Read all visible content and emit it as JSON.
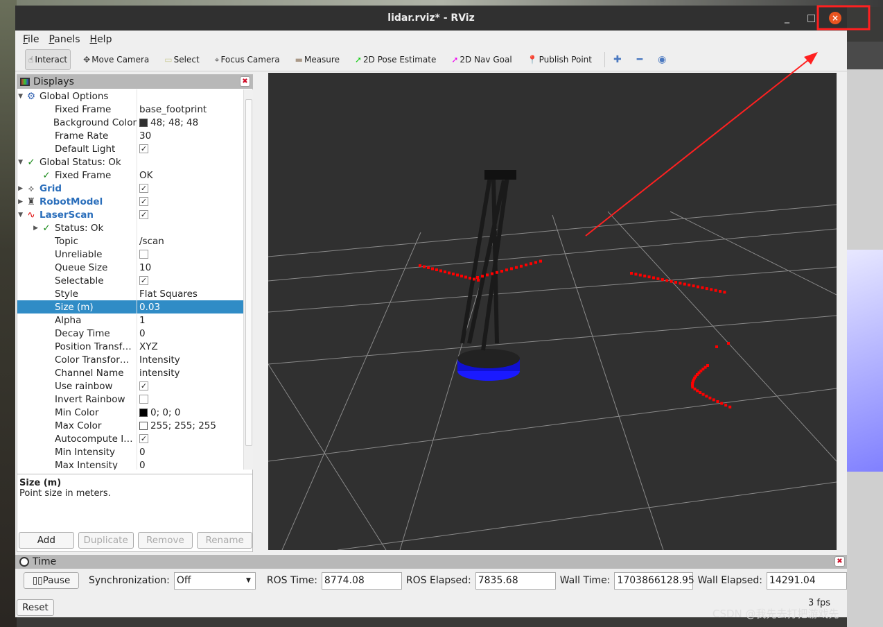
{
  "window": {
    "title": "lidar.rviz* - RViz",
    "minimize": "_",
    "maximize": "□",
    "close": "×"
  },
  "menu": [
    "File",
    "Panels",
    "Help"
  ],
  "toolbar": {
    "tools": [
      {
        "label": "Interact",
        "icon": "hand-icon",
        "active": true
      },
      {
        "label": "Move Camera",
        "icon": "move-camera-icon"
      },
      {
        "label": "Select",
        "icon": "select-icon"
      },
      {
        "label": "Focus Camera",
        "icon": "focus-camera-icon"
      },
      {
        "label": "Measure",
        "icon": "ruler-icon"
      },
      {
        "label": "2D Pose Estimate",
        "icon": "green-arrow-icon"
      },
      {
        "label": "2D Nav Goal",
        "icon": "magenta-arrow-icon"
      },
      {
        "label": "Publish Point",
        "icon": "map-pin-icon"
      }
    ],
    "extra": [
      "plus-icon",
      "minus-icon",
      "eye-icon"
    ]
  },
  "displays": {
    "title": "Displays",
    "rows": [
      {
        "lvl": 0,
        "exp": "down",
        "icon": "gear-icon",
        "key": "Global Options",
        "val": ""
      },
      {
        "lvl": 1,
        "key": "Fixed Frame",
        "val": "base_footprint"
      },
      {
        "lvl": 1,
        "key": "Background Color",
        "val": "48; 48; 48",
        "swatch": "#303030"
      },
      {
        "lvl": 1,
        "key": "Frame Rate",
        "val": "30"
      },
      {
        "lvl": 1,
        "key": "Default Light",
        "check": true
      },
      {
        "lvl": 0,
        "exp": "down",
        "icon": "check-icon",
        "key": "Global Status: Ok",
        "val": ""
      },
      {
        "lvl": 1,
        "icon": "check-icon",
        "key": "Fixed Frame",
        "val": "OK"
      },
      {
        "lvl": 0,
        "exp": "right",
        "icon": "grid-icon",
        "key": "Grid",
        "bold": true,
        "check": true
      },
      {
        "lvl": 0,
        "exp": "right",
        "icon": "robot-icon",
        "key": "RobotModel",
        "bold": true,
        "check": true
      },
      {
        "lvl": 0,
        "exp": "down",
        "icon": "laser-icon",
        "key": "LaserScan",
        "bold": true,
        "check": true
      },
      {
        "lvl": 1,
        "exp": "right",
        "icon": "check-icon",
        "key": "Status: Ok",
        "val": ""
      },
      {
        "lvl": 1,
        "key": "Topic",
        "val": "/scan"
      },
      {
        "lvl": 1,
        "key": "Unreliable",
        "check": false
      },
      {
        "lvl": 1,
        "key": "Queue Size",
        "val": "10"
      },
      {
        "lvl": 1,
        "key": "Selectable",
        "check": true
      },
      {
        "lvl": 1,
        "key": "Style",
        "val": "Flat Squares"
      },
      {
        "lvl": 1,
        "key": "Size (m)",
        "val": "0.03",
        "selected": true
      },
      {
        "lvl": 1,
        "key": "Alpha",
        "val": "1"
      },
      {
        "lvl": 1,
        "key": "Decay Time",
        "val": "0"
      },
      {
        "lvl": 1,
        "key": "Position Transf…",
        "val": "XYZ"
      },
      {
        "lvl": 1,
        "key": "Color Transfor…",
        "val": "Intensity"
      },
      {
        "lvl": 1,
        "key": "Channel Name",
        "val": "intensity"
      },
      {
        "lvl": 1,
        "key": "Use rainbow",
        "check": true
      },
      {
        "lvl": 1,
        "key": "Invert Rainbow",
        "check": false
      },
      {
        "lvl": 1,
        "key": "Min Color",
        "val": "0; 0; 0",
        "swatch": "#000000"
      },
      {
        "lvl": 1,
        "key": "Max Color",
        "val": "255; 255; 255",
        "swatch": "#ffffff"
      },
      {
        "lvl": 1,
        "key": "Autocompute I…",
        "check": true
      },
      {
        "lvl": 1,
        "key": "Min Intensity",
        "val": "0"
      },
      {
        "lvl": 1,
        "key": "Max Intensity",
        "val": "0"
      }
    ],
    "desc_title": "Size (m)",
    "desc_text": "Point size in meters.",
    "buttons": {
      "add": "Add",
      "duplicate": "Duplicate",
      "remove": "Remove",
      "rename": "Rename"
    }
  },
  "time": {
    "title": "Time",
    "pause": "Pause",
    "sync_label": "Synchronization:",
    "sync_value": "Off",
    "ros_time_label": "ROS Time:",
    "ros_time": "8774.08",
    "ros_elapsed_label": "ROS Elapsed:",
    "ros_elapsed": "7835.68",
    "wall_time_label": "Wall Time:",
    "wall_time": "1703866128.95",
    "wall_elapsed_label": "Wall Elapsed:",
    "wall_elapsed": "14291.04",
    "reset": "Reset",
    "fps": "3 fps"
  },
  "watermark": "CSDN @我先去打把游戏先",
  "colors": {
    "accent": "#308cc6",
    "close": "#e95420",
    "annotation": "#ff2020",
    "scan": "#ff0000",
    "robot_base": "#1a1aff"
  }
}
